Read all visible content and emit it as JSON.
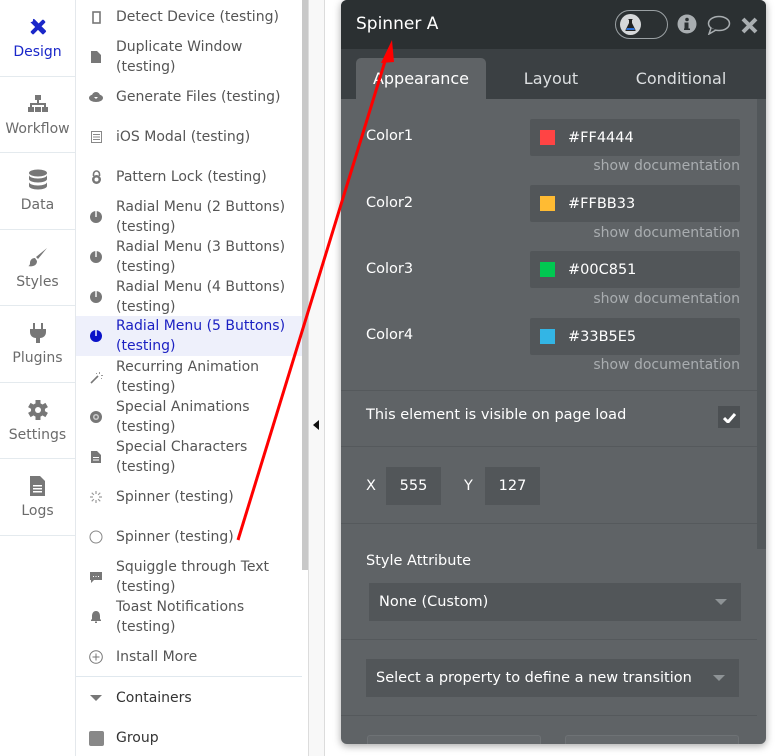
{
  "nav": {
    "items": [
      {
        "label": "Design",
        "icon": "design-icon",
        "active": true
      },
      {
        "label": "Workflow",
        "icon": "workflow-icon"
      },
      {
        "label": "Data",
        "icon": "database-icon"
      },
      {
        "label": "Styles",
        "icon": "brush-icon"
      },
      {
        "label": "Plugins",
        "icon": "plug-icon"
      },
      {
        "label": "Settings",
        "icon": "gear-icon"
      },
      {
        "label": "Logs",
        "icon": "document-icon"
      }
    ]
  },
  "element_list": {
    "items": [
      {
        "label": "Detect Device (testing)",
        "icon": "mobile-icon"
      },
      {
        "label": "Duplicate Window (testing)",
        "icon": "file-icon"
      },
      {
        "label": "Generate Files (testing)",
        "icon": "cloud-download-icon"
      },
      {
        "label": "iOS Modal (testing)",
        "icon": "list-icon"
      },
      {
        "label": "Pattern Lock (testing)",
        "icon": "lock-icon"
      },
      {
        "label": "Radial Menu (2 Buttons) (testing)",
        "icon": "pie-icon"
      },
      {
        "label": "Radial Menu (3 Buttons) (testing)",
        "icon": "pie-icon"
      },
      {
        "label": "Radial Menu (4 Buttons) (testing)",
        "icon": "pie-icon"
      },
      {
        "label": "Radial Menu (5 Buttons) (testing)",
        "icon": "pie-icon",
        "selected": true
      },
      {
        "label": "Recurring Animation (testing)",
        "icon": "magic-wand-icon"
      },
      {
        "label": "Special Animations (testing)",
        "icon": "disc-icon"
      },
      {
        "label": "Special Characters (testing)",
        "icon": "file-text-icon"
      },
      {
        "label": "Spinner (testing)",
        "icon": "spinner-icon"
      },
      {
        "label": "Spinner (testing)",
        "icon": "circle-icon"
      },
      {
        "label": "Squiggle through Text (testing)",
        "icon": "comment-icon"
      },
      {
        "label": "Toast Notifications (testing)",
        "icon": "bell-icon"
      },
      {
        "label": "Install More",
        "icon": "plus-circle-icon"
      }
    ],
    "category": {
      "label": "Containers",
      "icon": "caret-down-icon"
    },
    "group": {
      "label": "Group",
      "icon": "square-icon"
    }
  },
  "panel": {
    "title": "Spinner A",
    "header_icons": [
      "flask-toggle-icon",
      "info-icon",
      "comment-icon",
      "close-icon"
    ],
    "tabs": [
      {
        "label": "Appearance",
        "active": true
      },
      {
        "label": "Layout"
      },
      {
        "label": "Conditional"
      }
    ],
    "colors": [
      {
        "label": "Color1",
        "value": "#FF4444",
        "swatch": "#FF4444",
        "doc": "show documentation"
      },
      {
        "label": "Color2",
        "value": "#FFBB33",
        "swatch": "#FFBB33",
        "doc": "show documentation"
      },
      {
        "label": "Color3",
        "value": "#00C851",
        "swatch": "#00C851",
        "doc": "show documentation"
      },
      {
        "label": "Color4",
        "value": "#33B5E5",
        "swatch": "#33B5E5",
        "doc": "show documentation"
      }
    ],
    "visible_on_load": {
      "label": "This element is visible on page load",
      "checked": true
    },
    "position": {
      "x_label": "X",
      "x_value": "555",
      "y_label": "Y",
      "y_value": "127"
    },
    "style_attribute": {
      "label": "Style Attribute",
      "value": "None (Custom)"
    },
    "transition": {
      "placeholder": "Select a property to define a new transition"
    }
  },
  "annotation": {
    "color": "#FF0000"
  }
}
